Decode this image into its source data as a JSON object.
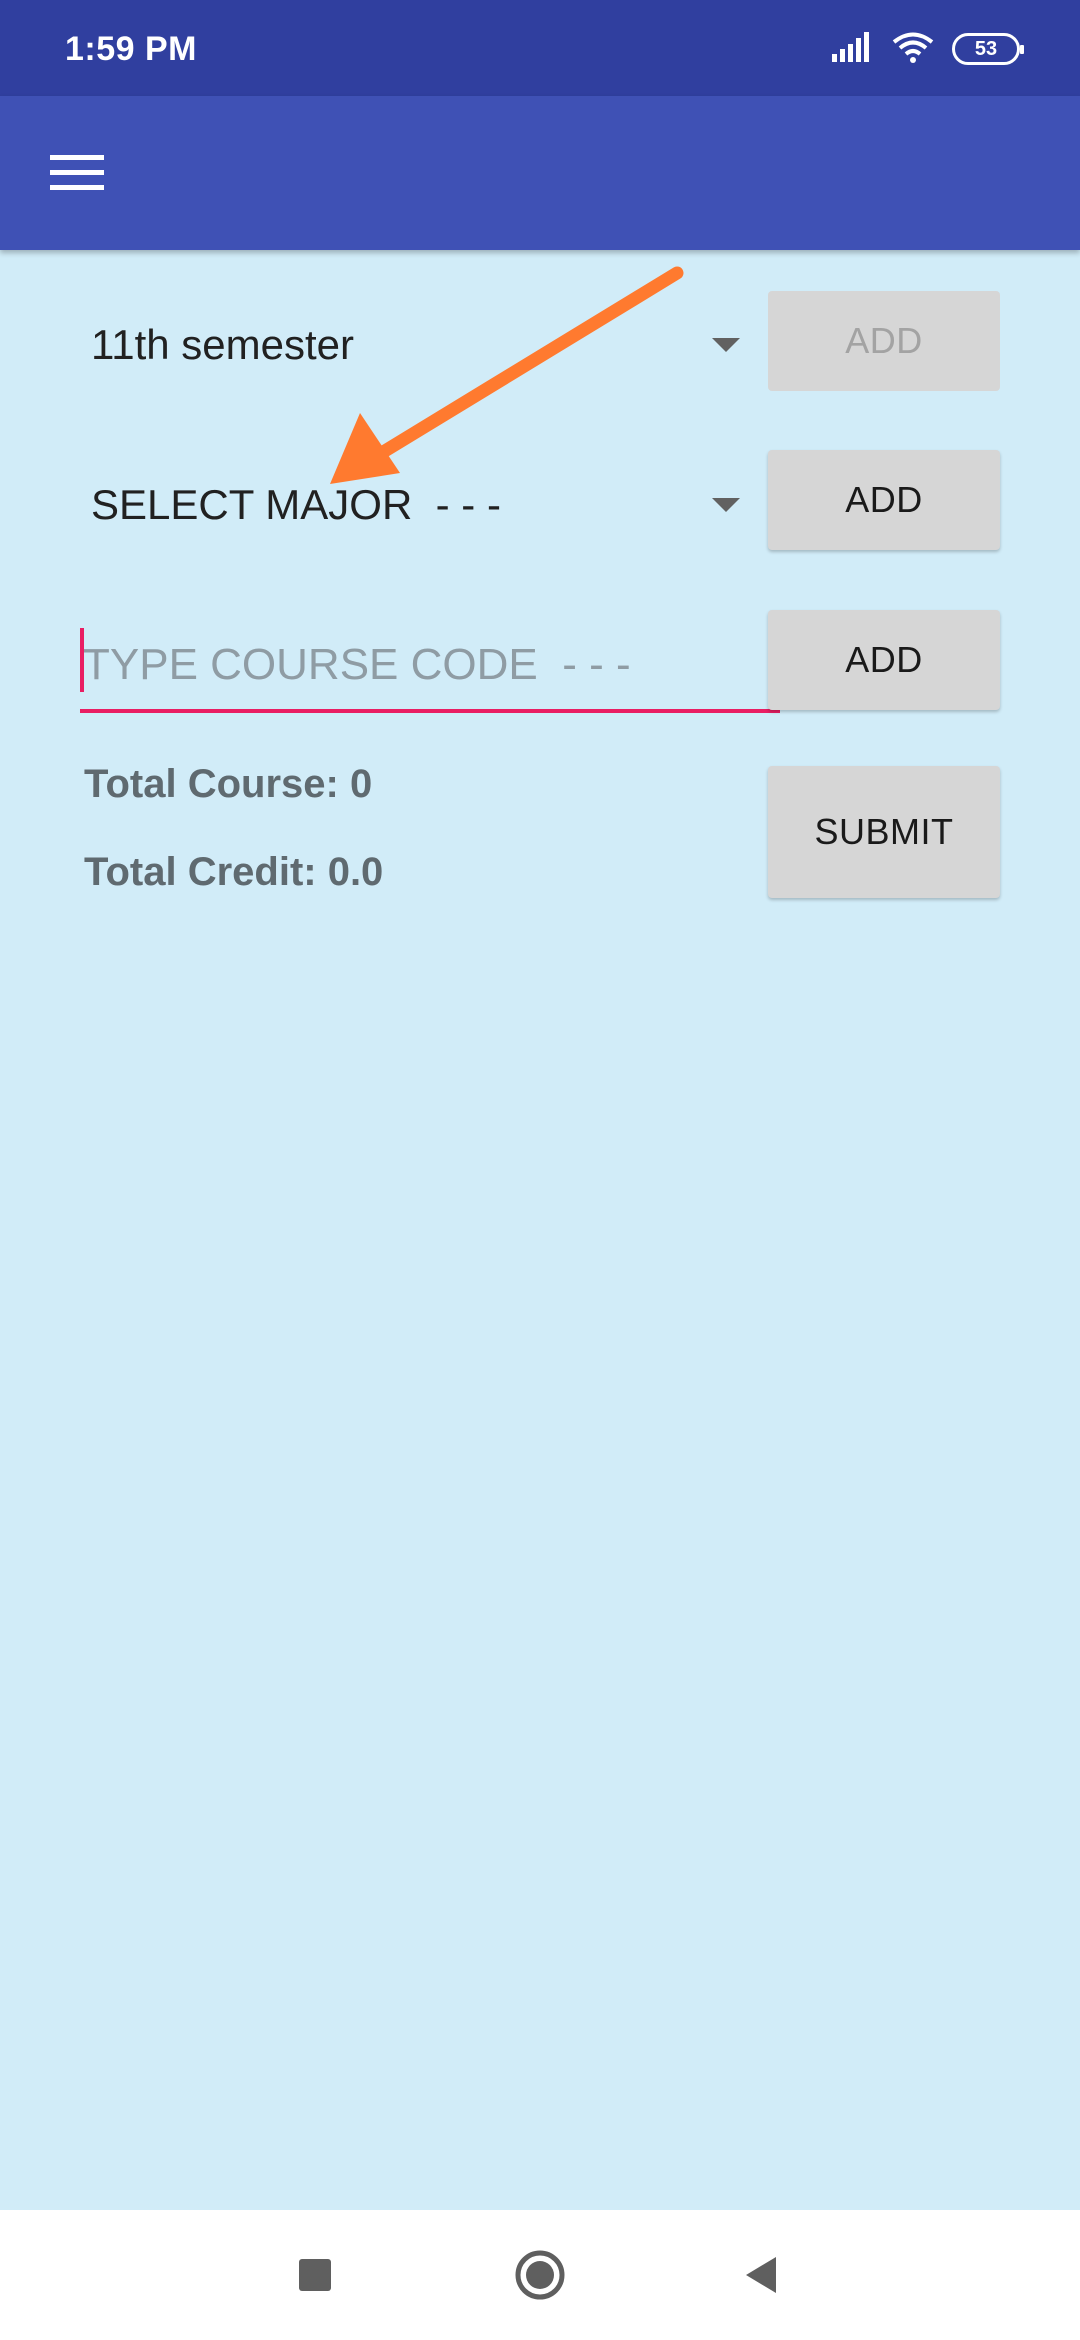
{
  "status_bar": {
    "time": "1:59 PM",
    "battery": "53",
    "icons": [
      "signal-icon",
      "wifi-icon",
      "battery-icon"
    ]
  },
  "app_bar": {
    "menu_icon": "hamburger-menu-icon"
  },
  "form": {
    "semester_spinner": {
      "value": "11th semester"
    },
    "semester_add_label": "ADD",
    "major_spinner": {
      "value": "SELECT MAJOR  - - -"
    },
    "major_add_label": "ADD",
    "course_code": {
      "value": "",
      "placeholder": "TYPE COURSE CODE  - - -"
    },
    "course_add_label": "ADD",
    "submit_label": "SUBMIT",
    "total_course": "Total Course: 0",
    "total_credit": "Total Credit: 0.0"
  },
  "annotation": {
    "arrow_color": "#ff7a2f"
  },
  "colors": {
    "status_bar": "#303f9f",
    "app_bar": "#3f51b5",
    "background": "#d1ecf8",
    "accent": "#e91e63"
  },
  "nav_bar": {
    "icons": [
      "recents-square-icon",
      "home-circle-icon",
      "back-triangle-icon"
    ]
  }
}
